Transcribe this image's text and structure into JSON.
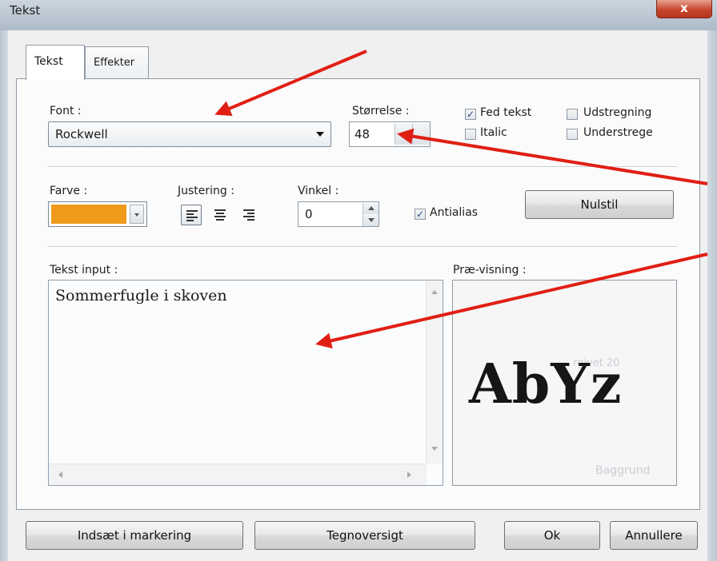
{
  "window": {
    "title": "Tekst",
    "close_label": "x"
  },
  "tabs": [
    {
      "label": "Tekst",
      "active": true
    },
    {
      "label": "Effekter",
      "active": false
    }
  ],
  "font": {
    "label": "Font :",
    "value": "Rockwell"
  },
  "size": {
    "label": "Størrelse :",
    "value": "48"
  },
  "styles": {
    "bold": {
      "label": "Fed tekst",
      "checked": true
    },
    "italic": {
      "label": "Italic",
      "checked": false
    },
    "strike": {
      "label": "Udstregning",
      "checked": false
    },
    "underline": {
      "label": "Understrege",
      "checked": false
    }
  },
  "color": {
    "label": "Farve :",
    "value": "#ef9a1a"
  },
  "alignment": {
    "label": "Justering :",
    "options": [
      "left",
      "center",
      "right"
    ],
    "selected": "left"
  },
  "angle": {
    "label": "Vinkel :",
    "value": "0"
  },
  "antialias": {
    "label": "Antialias",
    "checked": true
  },
  "reset_label": "Nulstil",
  "text_input": {
    "label": "Tekst input :",
    "value": "Sommerfugle i skoven"
  },
  "preview": {
    "label": "Præ-visning :",
    "sample": "AbYz",
    "background_word": "Baggrund",
    "ghost_text": "rgivet 20"
  },
  "footer": {
    "insert_label": "Indsæt i markering",
    "charmap_label": "Tegnoversigt",
    "ok_label": "Ok",
    "cancel_label": "Annullere"
  },
  "colors": {
    "annotation_arrow": "#e01f14",
    "accent_color_value": "#ef9a1a"
  }
}
